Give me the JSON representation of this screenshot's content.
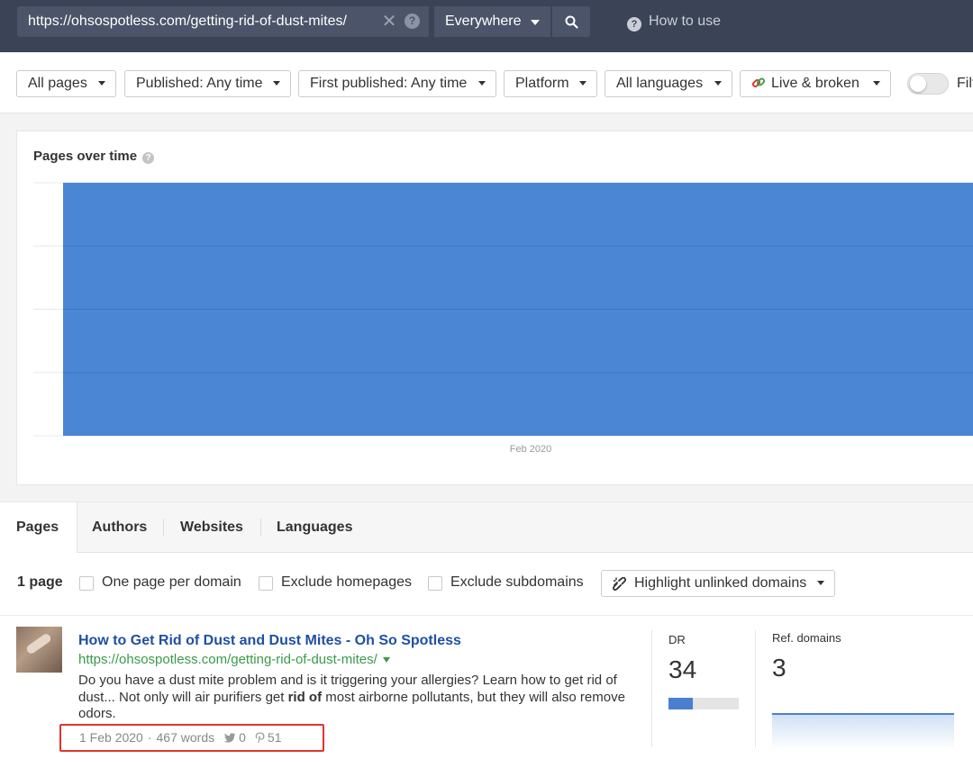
{
  "topbar": {
    "url_value": "https://ohsospotless.com/getting-rid-of-dust-mites/",
    "mode": "Everywhere",
    "how_to_use": "How to use"
  },
  "filters": {
    "all_pages": "All pages",
    "published": "Published: Any time",
    "first_published": "First published: Any time",
    "platform": "Platform",
    "languages": "All languages",
    "live_broken": "Live & broken",
    "toggle_label": "Filt"
  },
  "chart": {
    "title": "Pages over time"
  },
  "chart_data": {
    "type": "area",
    "title": "Pages over time",
    "x": [
      "Feb 2020"
    ],
    "series": [
      {
        "values": [
          1
        ]
      }
    ],
    "fill_color": "#4a86d4",
    "grid": true
  },
  "tabs": [
    {
      "label": "Pages"
    },
    {
      "label": "Authors"
    },
    {
      "label": "Websites"
    },
    {
      "label": "Languages"
    }
  ],
  "options": {
    "count": "1 page",
    "one_per_domain": "One page per domain",
    "exclude_homepages": "Exclude homepages",
    "exclude_subdomains": "Exclude subdomains",
    "highlight_unlinked": "Highlight unlinked domains"
  },
  "result": {
    "title": "How to Get Rid of Dust and Dust Mites - Oh So Spotless",
    "url": "https://ohsospotless.com/getting-rid-of-dust-mites/",
    "desc_part1": "Do you have a dust mite problem and is it triggering your allergies? Learn how to get rid of dust... Not only will air purifiers get ",
    "desc_bold": "rid of",
    "desc_part2": " most airborne pollutants, but they will also remove odors.",
    "date": "1 Feb 2020",
    "words": "467 words",
    "tweets": "0",
    "pins": "51",
    "dr_label": "DR",
    "dr_value": "34",
    "dr_fraction": 0.34,
    "ref_label": "Ref. domains",
    "ref_value": "3"
  }
}
